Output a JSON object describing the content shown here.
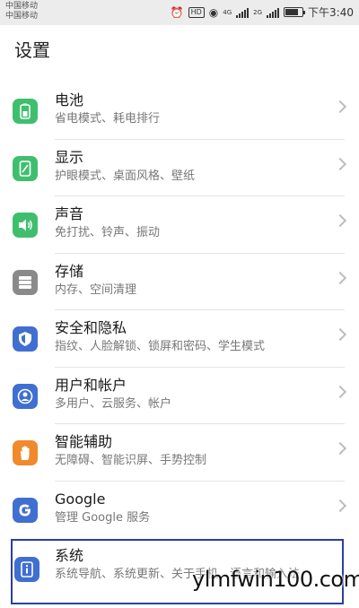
{
  "status_bar": {
    "carrier_1": "中国移动",
    "carrier_2": "中国移动",
    "time": "下午3:40",
    "hd": "HD",
    "net_1": "4G",
    "net_2": "2G"
  },
  "header": {
    "title": "设置"
  },
  "settings": [
    {
      "name": "battery",
      "title": "电池",
      "subtitle": "省电模式、耗电排行",
      "icon": "battery-icon",
      "color": "#3fbf6e"
    },
    {
      "name": "display",
      "title": "显示",
      "subtitle": "护眼模式、桌面风格、壁纸",
      "icon": "display-icon",
      "color": "#3fbf6e"
    },
    {
      "name": "sound",
      "title": "声音",
      "subtitle": "免打扰、铃声、振动",
      "icon": "speaker-icon",
      "color": "#3fbf6e"
    },
    {
      "name": "storage",
      "title": "存储",
      "subtitle": "内存、空间清理",
      "icon": "storage-icon",
      "color": "#8a8a8a"
    },
    {
      "name": "security",
      "title": "安全和隐私",
      "subtitle": "指纹、人脸解锁、锁屏和密码、学生模式",
      "icon": "shield-icon",
      "color": "#3f6fd1"
    },
    {
      "name": "accounts",
      "title": "用户和帐户",
      "subtitle": "多用户、云服务、帐户",
      "icon": "user-icon",
      "color": "#3f6fd1"
    },
    {
      "name": "assist",
      "title": "智能辅助",
      "subtitle": "无障碍、智能识屏、手势控制",
      "icon": "hand-icon",
      "color": "#f08a2c"
    },
    {
      "name": "google",
      "title": "Google",
      "subtitle": "管理 Google 服务",
      "icon": "google-icon",
      "color": "#3f6fd1"
    }
  ],
  "system": {
    "title": "系统",
    "subtitle": "系统导航、系统更新、关于手机、语言和输入法",
    "icon": "info-icon",
    "color": "#3f6fd1"
  },
  "watermark": {
    "text": "ylmfwin100.com"
  }
}
